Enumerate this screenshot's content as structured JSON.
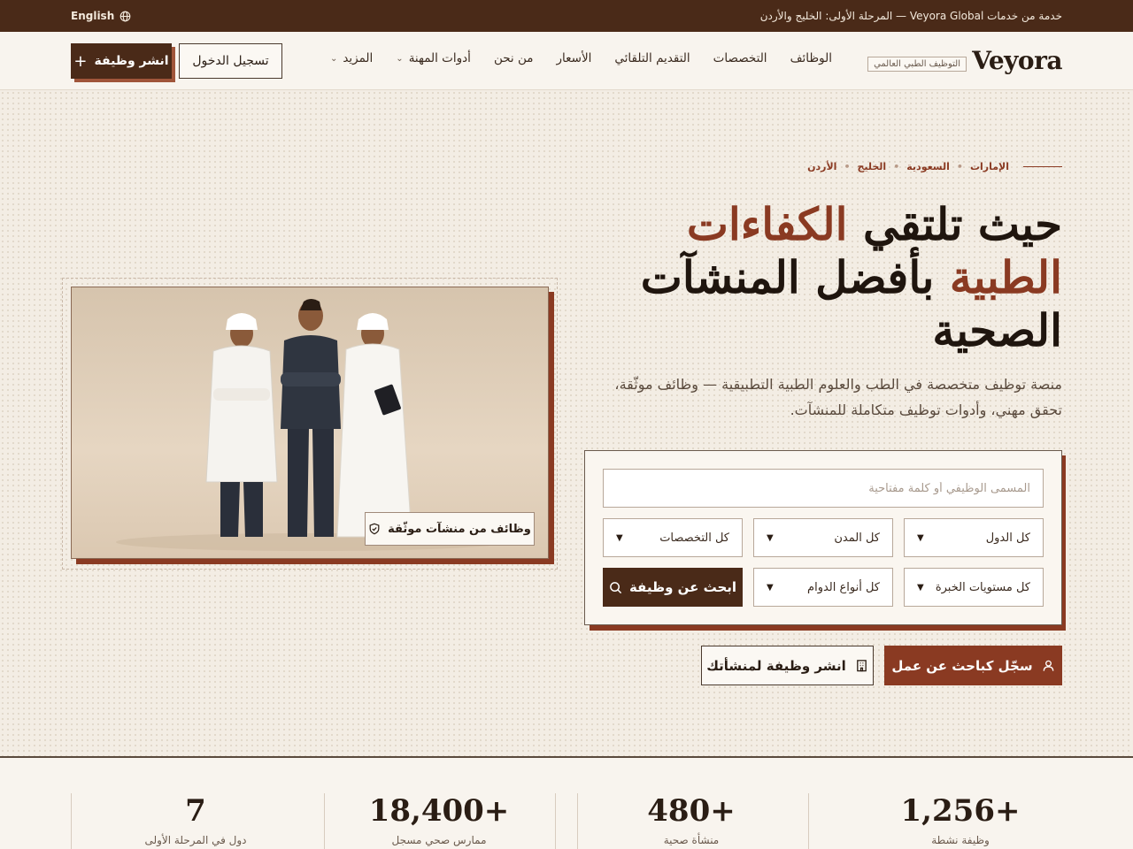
{
  "topbar": {
    "notice": "خدمة من خدمات Veyora Global — المرحلة الأولى: الخليج والأردن",
    "language": "English",
    "language_icon": "globe-icon"
  },
  "header": {
    "logo": "Veyora",
    "tagline": "التوظيف الطبي العالمي",
    "nav": [
      {
        "label": "الوظائف",
        "dropdown": false
      },
      {
        "label": "التخصصات",
        "dropdown": false
      },
      {
        "label": "التقديم التلقائي",
        "dropdown": false
      },
      {
        "label": "الأسعار",
        "dropdown": false
      },
      {
        "label": "من نحن",
        "dropdown": false
      },
      {
        "label": "أدوات المهنة",
        "dropdown": true
      },
      {
        "label": "المزيد",
        "dropdown": true
      }
    ],
    "login_label": "تسجيل الدخول",
    "post_job_label": "انشر وظيفة"
  },
  "hero": {
    "regions": [
      "الإمارات",
      "السعودية",
      "الخليج",
      "الأردن"
    ],
    "headline_part1": "حيث تلتقي ",
    "headline_accent1": "الكفاءات",
    "headline_accent2": "الطبية",
    "headline_part2": " بأفضل المنشآت الصحية",
    "subtext": "منصة توظيف متخصصة في الطب والعلوم الطبية التطبيقية — وظائف موثّقة، تحقق مهني، وأدوات توظيف متكاملة للمنشآت.",
    "photo_badge": "وظائف من منشآت موثّقة",
    "search": {
      "placeholder": "المسمى الوظيفي أو كلمة مفتاحية",
      "country": "كل الدول",
      "city": "كل المدن",
      "specialty": "كل التخصصات",
      "experience": "كل مستويات الخبرة",
      "schedule": "كل أنواع الدوام",
      "button": "ابحث عن وظيفة"
    },
    "cta_seeker": "سجّل كباحث عن عمل",
    "cta_employer": "انشر وظيفة لمنشأتك"
  },
  "stats": [
    {
      "value": "1,256+",
      "label": "وظيفة نشطة"
    },
    {
      "value": "480+",
      "label": "منشأة صحية"
    },
    {
      "value": "18,400+",
      "label": "ممارس صحي مسجل"
    },
    {
      "value": "7",
      "label": "دول في المرحلة الأولى"
    }
  ],
  "colors": {
    "brand_dark": "#4a2a18",
    "accent": "#8a3a22",
    "background": "#f3ede4"
  }
}
